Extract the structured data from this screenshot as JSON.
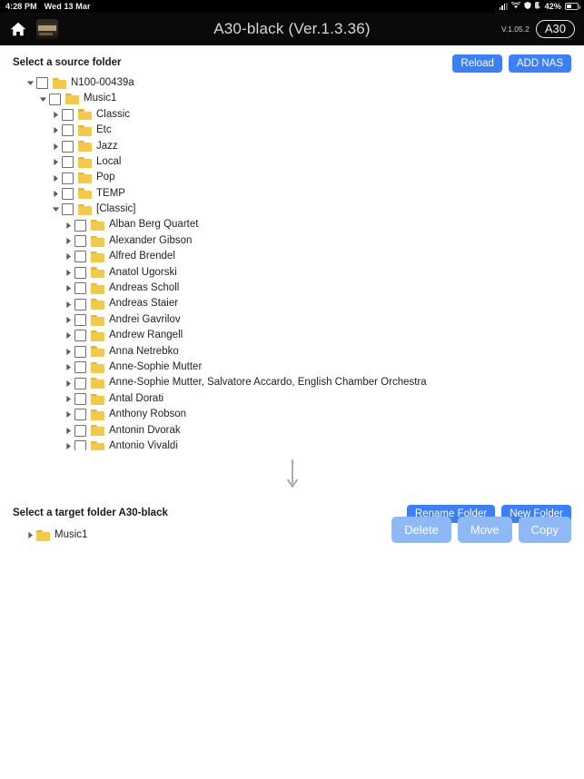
{
  "statusbar": {
    "time": "4:28 PM",
    "date": "Wed 13 Mar",
    "battery_percent": "42%",
    "icons": [
      "signal-icon",
      "wifi-icon",
      "shield-icon",
      "moon-icon",
      "battery-icon"
    ]
  },
  "appbar": {
    "home_icon": "home-icon",
    "app_thumb": "app-thumbnail-icon",
    "title": "A30-black (Ver.1.3.36)",
    "version": "V.1.05.2",
    "device_badge": "A30"
  },
  "source": {
    "title": "Select a source folder",
    "reload_label": "Reload",
    "add_nas_label": "ADD NAS",
    "nodes": [
      {
        "label": "N100-00439a",
        "depth": 0,
        "expanded": true,
        "checkbox": true
      },
      {
        "label": "Music1",
        "depth": 1,
        "expanded": true,
        "checkbox": true
      },
      {
        "label": "Classic",
        "depth": 2,
        "expanded": false,
        "checkbox": true
      },
      {
        "label": "Etc",
        "depth": 2,
        "expanded": false,
        "checkbox": true
      },
      {
        "label": "Jazz",
        "depth": 2,
        "expanded": false,
        "checkbox": true
      },
      {
        "label": "Local",
        "depth": 2,
        "expanded": false,
        "checkbox": true
      },
      {
        "label": "Pop",
        "depth": 2,
        "expanded": false,
        "checkbox": true
      },
      {
        "label": "TEMP",
        "depth": 2,
        "expanded": false,
        "checkbox": true
      },
      {
        "label": "[Classic]",
        "depth": 2,
        "expanded": true,
        "checkbox": true
      },
      {
        "label": "Alban Berg Quartet",
        "depth": 3,
        "expanded": false,
        "checkbox": true
      },
      {
        "label": "Alexander Gibson",
        "depth": 3,
        "expanded": false,
        "checkbox": true
      },
      {
        "label": "Alfred Brendel",
        "depth": 3,
        "expanded": false,
        "checkbox": true
      },
      {
        "label": "Anatol Ugorski",
        "depth": 3,
        "expanded": false,
        "checkbox": true
      },
      {
        "label": "Andreas Scholl",
        "depth": 3,
        "expanded": false,
        "checkbox": true
      },
      {
        "label": "Andreas Staier",
        "depth": 3,
        "expanded": false,
        "checkbox": true
      },
      {
        "label": "Andrei Gavrilov",
        "depth": 3,
        "expanded": false,
        "checkbox": true
      },
      {
        "label": "Andrew Rangell",
        "depth": 3,
        "expanded": false,
        "checkbox": true
      },
      {
        "label": "Anna Netrebko",
        "depth": 3,
        "expanded": false,
        "checkbox": true
      },
      {
        "label": "Anne-Sophie Mutter",
        "depth": 3,
        "expanded": false,
        "checkbox": true
      },
      {
        "label": "Anne-Sophie Mutter, Salvatore Accardo, English Chamber Orchestra",
        "depth": 3,
        "expanded": false,
        "checkbox": true
      },
      {
        "label": "Antal Dorati",
        "depth": 3,
        "expanded": false,
        "checkbox": true
      },
      {
        "label": "Anthony Robson",
        "depth": 3,
        "expanded": false,
        "checkbox": true
      },
      {
        "label": "Antonin Dvorak",
        "depth": 3,
        "expanded": false,
        "checkbox": true
      },
      {
        "label": "Antonio Vivaldi",
        "depth": 3,
        "expanded": false,
        "checkbox": true
      },
      {
        "label": "",
        "depth": 3,
        "expanded": false,
        "checkbox": true
      }
    ]
  },
  "separator_icon": "arrow-down-icon",
  "target": {
    "title": "Select a target folder A30-black",
    "rename_label": "Rename Folder",
    "new_folder_label": "New Folder",
    "nodes": [
      {
        "label": "Music1",
        "depth": 0,
        "expanded": false,
        "checkbox": false
      }
    ]
  },
  "actions": {
    "delete_label": "Delete",
    "move_label": "Move",
    "copy_label": "Copy",
    "enabled": false
  },
  "colors": {
    "accent_blue": "#3d7ff5",
    "disabled_blue": "#8fb8f7",
    "folder_yellow": "#f0c94e",
    "folder_tab": "#e0b73e",
    "appbar_bg": "#0a0a0a",
    "text": "#222222"
  }
}
